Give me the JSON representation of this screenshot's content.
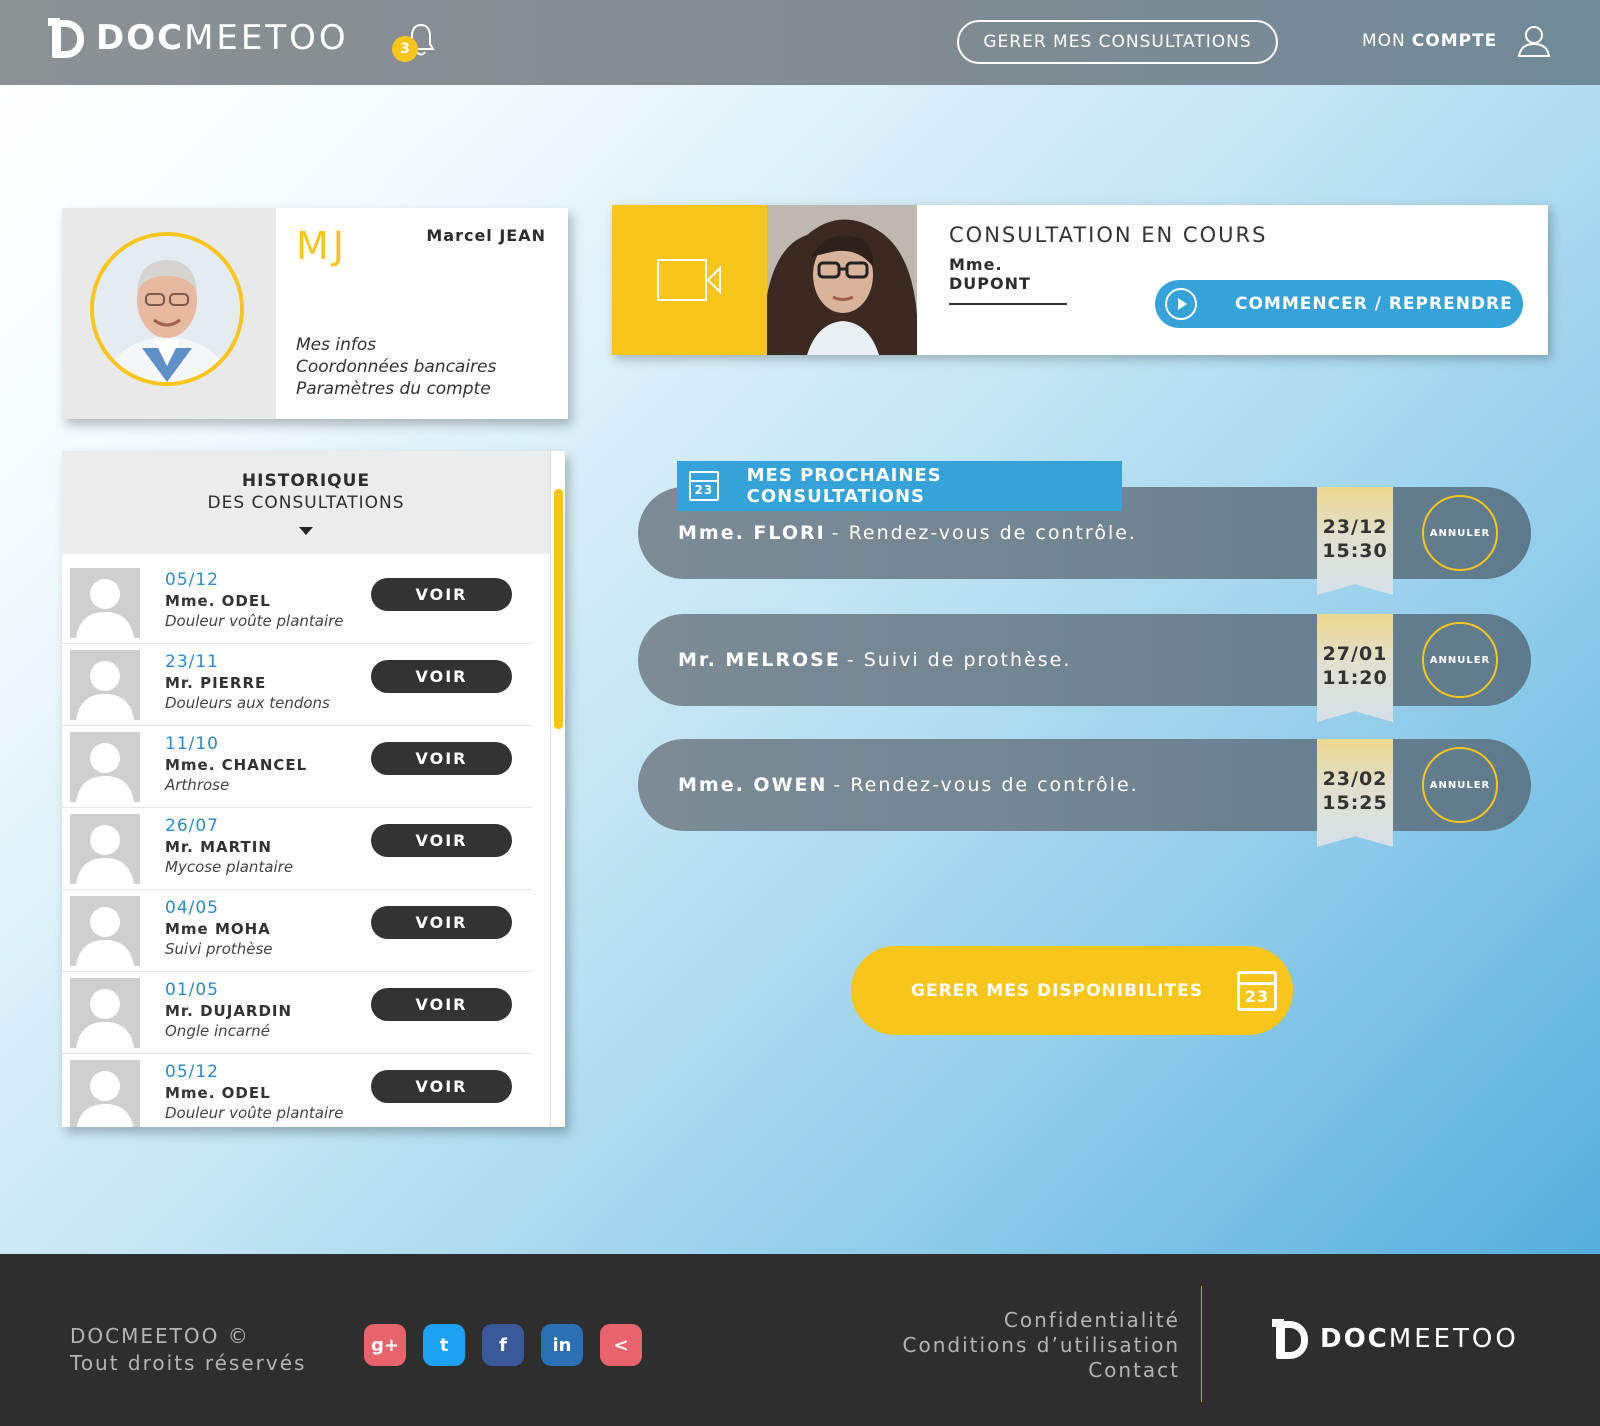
{
  "header": {
    "logo_bold": "DOC",
    "logo_light": "MEETOO",
    "notif_count": "3",
    "consult_button": "GERER MES CONSULTATIONS",
    "account_prefix": "MON",
    "account_bold": "COMPTE"
  },
  "profile": {
    "initials": "MJ",
    "name": "Marcel JEAN",
    "links": [
      "Mes infos",
      "Coordonnées bancaires",
      "Paramètres du compte"
    ]
  },
  "history": {
    "title": "HISTORIQUE",
    "subtitle": "DES CONSULTATIONS",
    "voir_label": "VOIR",
    "rows": [
      {
        "date": "05/12",
        "name": "Mme. ODEL",
        "desc": "Douleur voûte plantaire"
      },
      {
        "date": "23/11",
        "name": "Mr. PIERRE",
        "desc": "Douleurs aux tendons"
      },
      {
        "date": "11/10",
        "name": "Mme. CHANCEL",
        "desc": "Arthrose"
      },
      {
        "date": "26/07",
        "name": "Mr. MARTIN",
        "desc": "Mycose plantaire"
      },
      {
        "date": "04/05",
        "name": "Mme MOHA",
        "desc": "Suivi prothèse"
      },
      {
        "date": "01/05",
        "name": "Mr. DUJARDIN",
        "desc": "Ongle incarné"
      },
      {
        "date": "05/12",
        "name": "Mme. ODEL",
        "desc": "Douleur voûte plantaire"
      }
    ]
  },
  "current": {
    "title": "CONSULTATION EN COURS",
    "patient": "Mme. DUPONT",
    "button": "COMMENCER / REPRENDRE"
  },
  "upcoming": {
    "title": "MES PROCHAINES CONSULTATIONS",
    "calendar_day": "23",
    "cancel_label": "ANNULER",
    "items": [
      {
        "patient": "Mme. FLORI",
        "reason": "- Rendez-vous de contrôle.",
        "date": "23/12",
        "time": "15:30"
      },
      {
        "patient": "Mr. MELROSE",
        "reason": "- Suivi de prothèse.",
        "date": "27/01",
        "time": "11:20"
      },
      {
        "patient": "Mme. OWEN",
        "reason": "- Rendez-vous de contrôle.",
        "date": "23/02",
        "time": "15:25"
      }
    ]
  },
  "dispo": {
    "button": "GERER MES DISPONIBILITES",
    "calendar_day": "23"
  },
  "footer": {
    "copyright_line1": "DOCMEETOO ©",
    "copyright_line2": "Tout droits réservés",
    "links": [
      "Confidentialité",
      "Conditions d’utilisation",
      "Contact"
    ],
    "logo_bold": "DOC",
    "logo_light": "MEETOO",
    "socials": [
      {
        "icon": "google-plus-icon",
        "glyph": "g+",
        "color": "#e8636b"
      },
      {
        "icon": "twitter-icon",
        "glyph": "t",
        "color": "#1da1f2"
      },
      {
        "icon": "facebook-icon",
        "glyph": "f",
        "color": "#3b5998"
      },
      {
        "icon": "linkedin-icon",
        "glyph": "in",
        "color": "#2b6fb5"
      },
      {
        "icon": "share-icon",
        "glyph": "<",
        "color": "#e8636b"
      }
    ]
  },
  "colors": {
    "accent_yellow": "#f8c51b",
    "accent_blue": "#35a2d9",
    "footer_bg": "#2e2e2e",
    "appt_bar": "#6f8391"
  }
}
